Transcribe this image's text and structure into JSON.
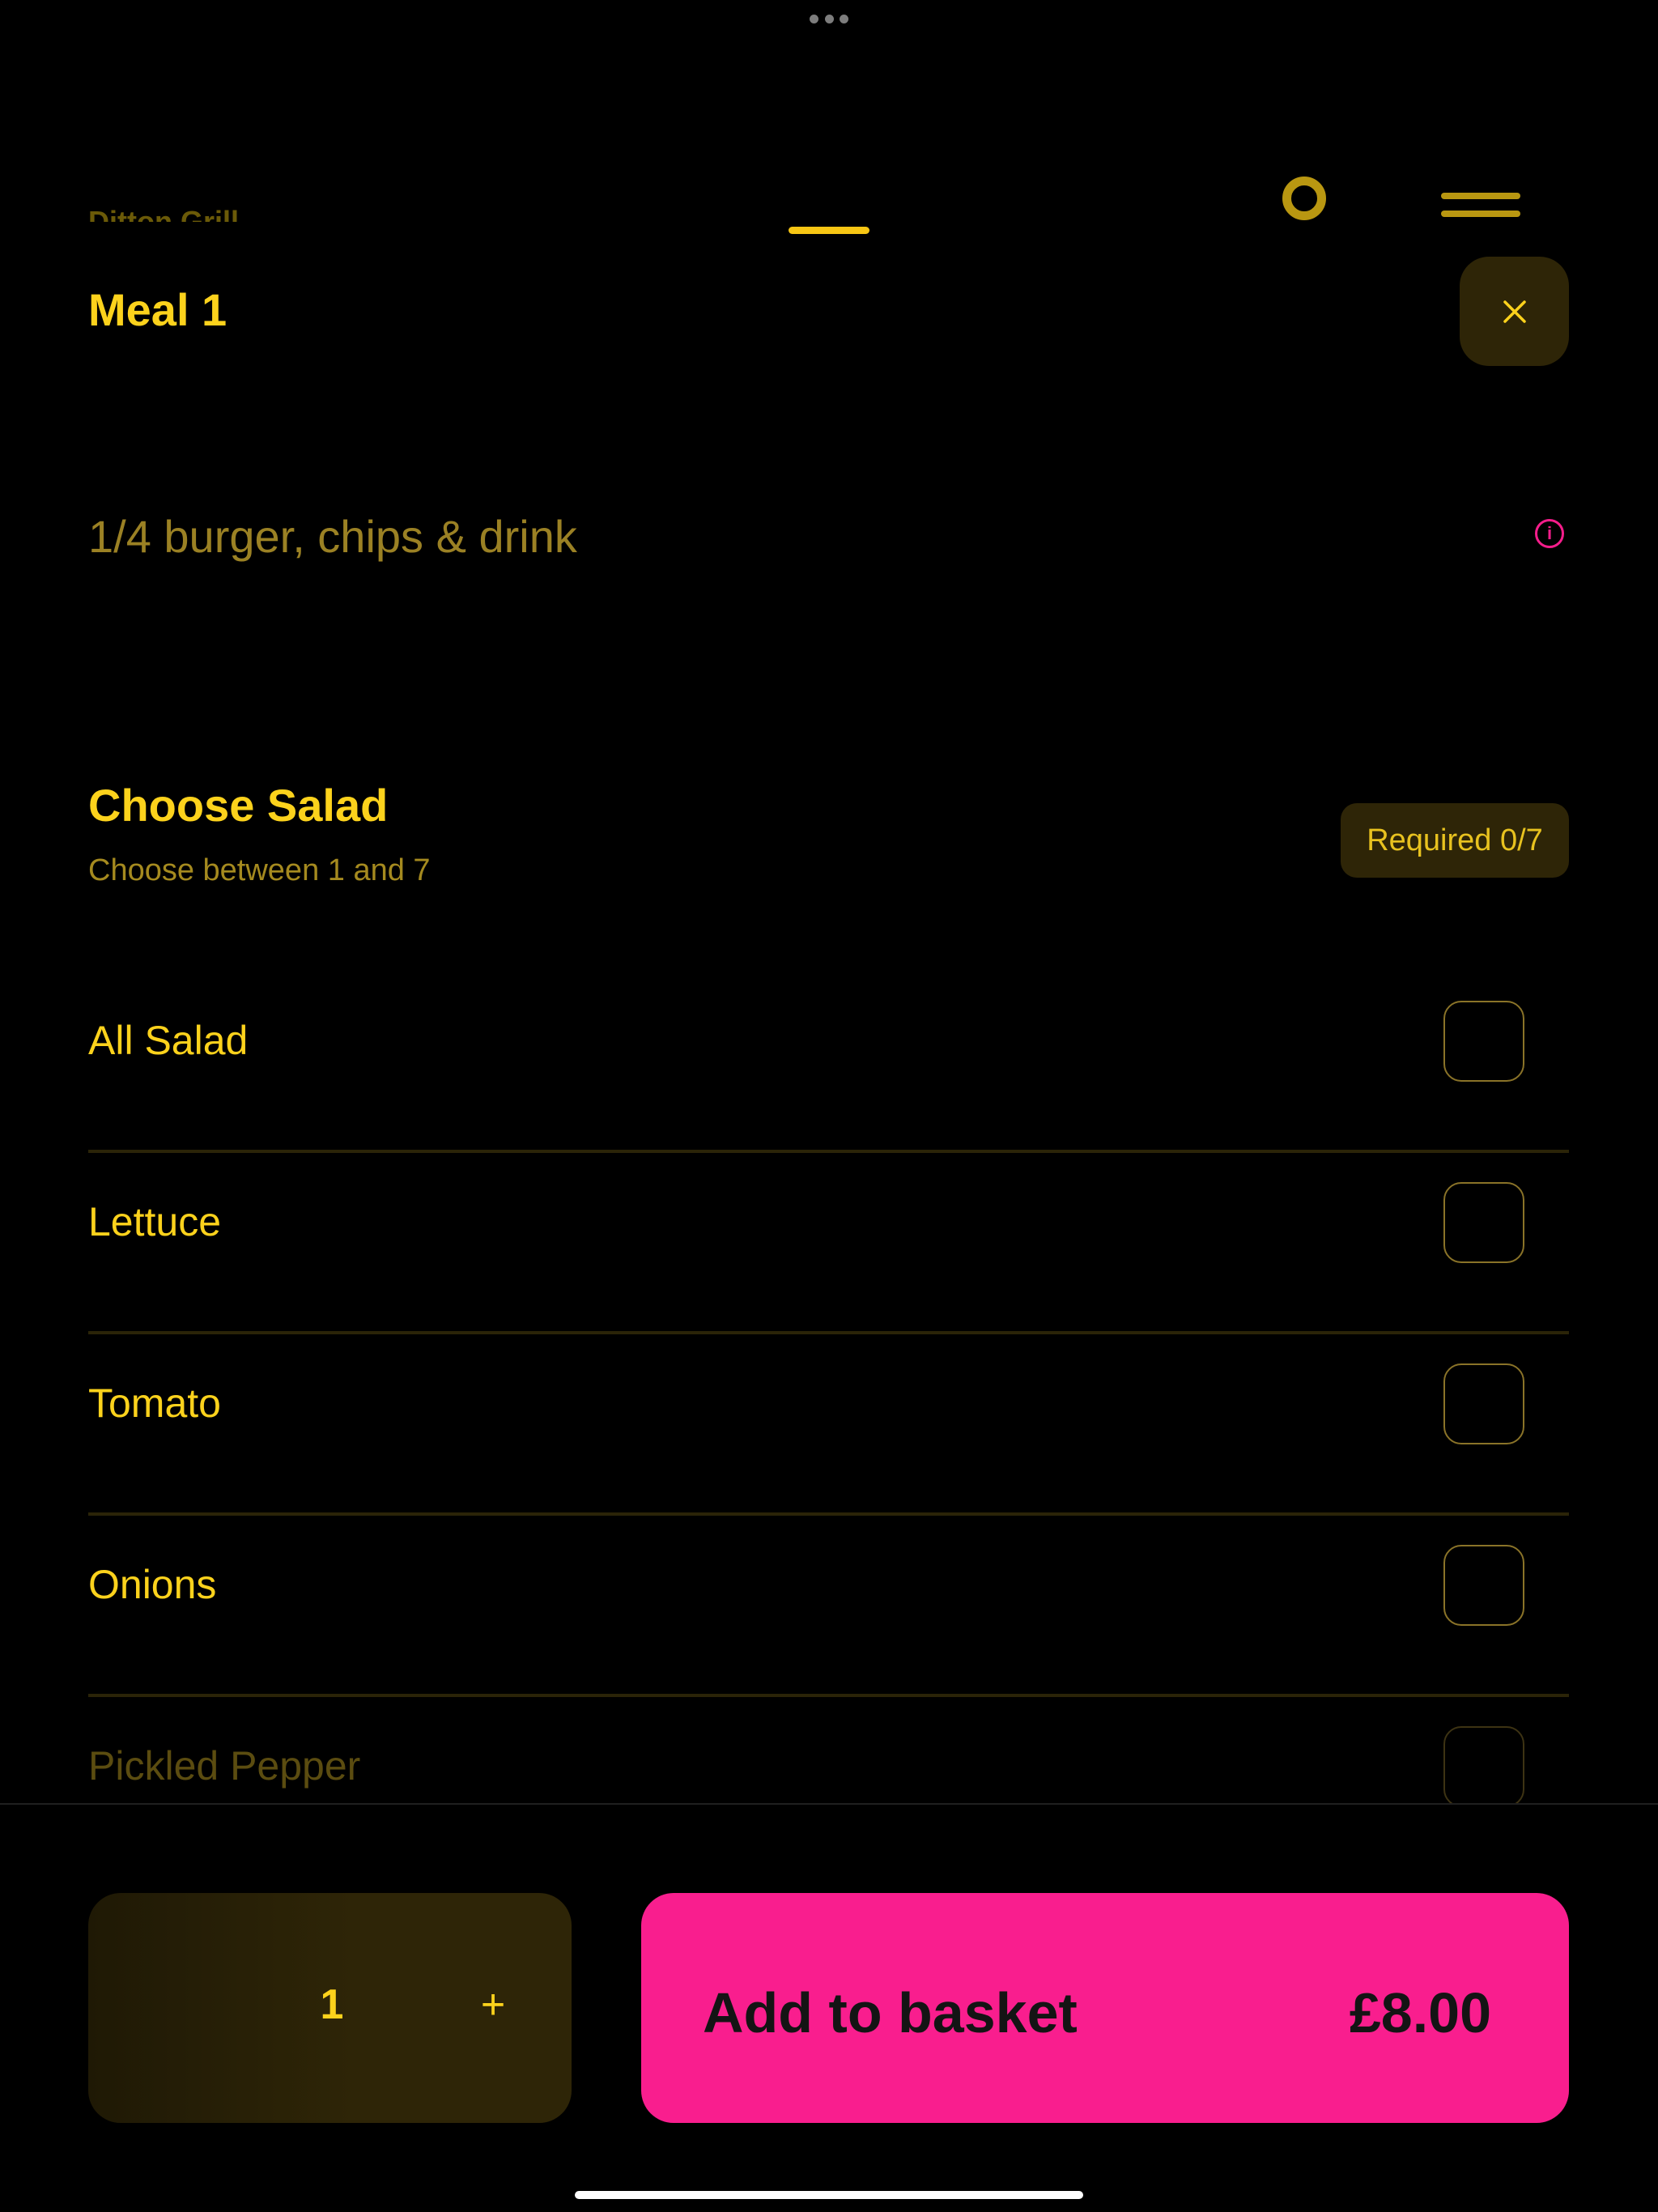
{
  "background_title": "Ditton Grill",
  "sheet": {
    "title": "Meal 1",
    "description": "1/4 burger, chips & drink"
  },
  "section": {
    "title": "Choose Salad",
    "subtitle": "Choose between 1 and 7",
    "badge": "Required 0/7"
  },
  "options": [
    {
      "label": "All Salad",
      "checked": false
    },
    {
      "label": "Lettuce",
      "checked": false
    },
    {
      "label": "Tomato",
      "checked": false
    },
    {
      "label": "Onions",
      "checked": false
    },
    {
      "label": "Pickled Pepper",
      "checked": false
    }
  ],
  "footer": {
    "quantity": "1",
    "plus": "+",
    "add_label": "Add to basket",
    "price": "£8.00"
  },
  "colors": {
    "accent": "#fcd21c",
    "pink": "#f91e8e",
    "panel": "#2e2507",
    "background": "#000000"
  },
  "icons": [
    "more-dots-icon",
    "close-icon",
    "info-icon",
    "menu-icon",
    "plus-icon"
  ]
}
